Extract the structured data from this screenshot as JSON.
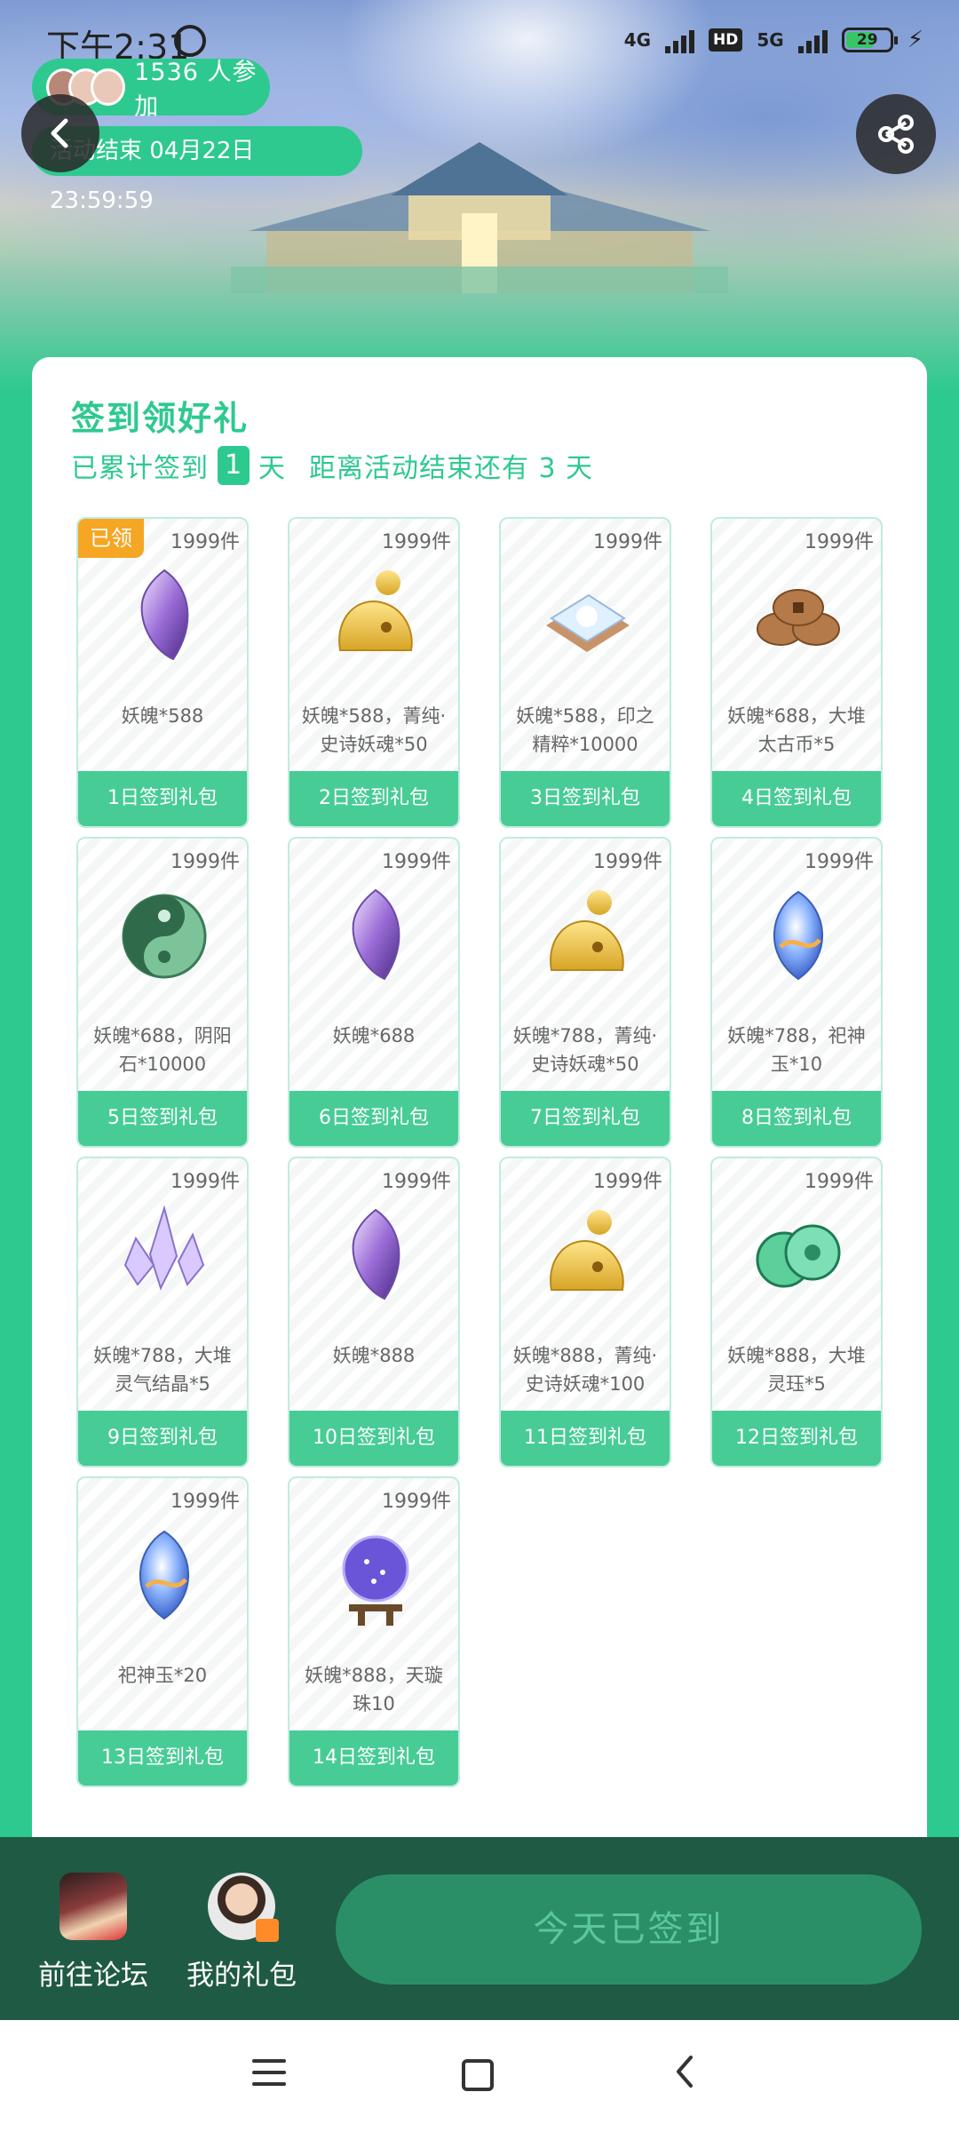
{
  "status_bar": {
    "time": "下午2:31",
    "network_1": "4G",
    "hd": "HD",
    "network_2": "5G",
    "battery": "29"
  },
  "hero": {
    "participants_text": "1536 人参加",
    "end_time_text": "活动结束 04月22日 23:59:59"
  },
  "card": {
    "title": "签到领好礼",
    "sub_prefix": "已累计签到",
    "days_signed": "1",
    "sub_unit": "天",
    "remaining_text": "距离活动结束还有 3 天"
  },
  "claimed_label": "已领",
  "items": [
    {
      "count": "1999件",
      "desc": "妖魄*588",
      "button": "1日签到礼包",
      "icon": "purple-crystal-icon"
    },
    {
      "count": "1999件",
      "desc": "妖魄*588，菁纯·史诗妖魂*50",
      "button": "2日签到礼包",
      "icon": "gold-spirit-icon"
    },
    {
      "count": "1999件",
      "desc": "妖魄*588，印之精粹*10000",
      "button": "3日签到礼包",
      "icon": "seal-essence-icon"
    },
    {
      "count": "1999件",
      "desc": "妖魄*688，大堆太古币*5",
      "button": "4日签到礼包",
      "icon": "ancient-coins-icon"
    },
    {
      "count": "1999件",
      "desc": "妖魄*688，阴阳石*10000",
      "button": "5日签到礼包",
      "icon": "yinyang-stone-icon"
    },
    {
      "count": "1999件",
      "desc": "妖魄*688",
      "button": "6日签到礼包",
      "icon": "purple-crystal-icon"
    },
    {
      "count": "1999件",
      "desc": "妖魄*788，菁纯·史诗妖魂*50",
      "button": "7日签到礼包",
      "icon": "gold-spirit-icon"
    },
    {
      "count": "1999件",
      "desc": "妖魄*788，祀神玉*10",
      "button": "8日签到礼包",
      "icon": "sacred-jade-icon"
    },
    {
      "count": "1999件",
      "desc": "妖魄*788，大堆灵气结晶*5",
      "button": "9日签到礼包",
      "icon": "aura-crystal-icon"
    },
    {
      "count": "1999件",
      "desc": "妖魄*888",
      "button": "10日签到礼包",
      "icon": "purple-crystal-icon"
    },
    {
      "count": "1999件",
      "desc": "妖魄*888，菁纯·史诗妖魂*100",
      "button": "11日签到礼包",
      "icon": "gold-spirit-icon"
    },
    {
      "count": "1999件",
      "desc": "妖魄*888，大堆灵珏*5",
      "button": "12日签到礼包",
      "icon": "spirit-jade-icon"
    },
    {
      "count": "1999件",
      "desc": "祀神玉*20",
      "button": "13日签到礼包",
      "icon": "sacred-jade-icon"
    },
    {
      "count": "1999件",
      "desc": "妖魄*888，天璇珠10",
      "button": "14日签到礼包",
      "icon": "star-orb-icon"
    }
  ],
  "bottom": {
    "forum_label": "前往论坛",
    "gift_label": "我的礼包",
    "checkin_label": "今天已签到"
  }
}
